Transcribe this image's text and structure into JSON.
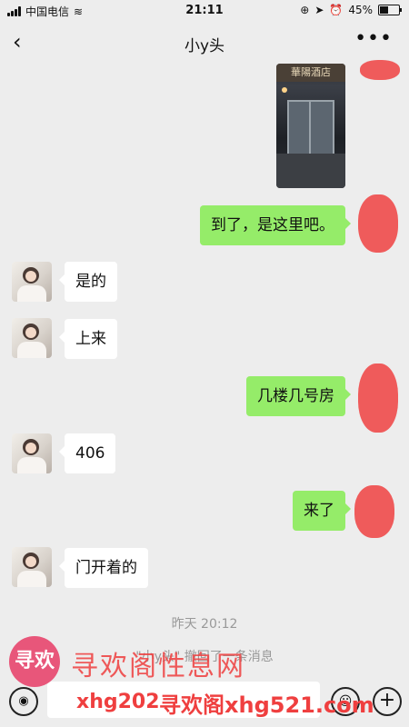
{
  "status_bar": {
    "carrier": "中国电信",
    "time": "21:11",
    "battery": "45%",
    "battery_level": 0.45
  },
  "nav": {
    "back_icon": "‹",
    "title": "小y头",
    "more_icon": "•••"
  },
  "image_message": {
    "sign_text": "華陽酒店"
  },
  "messages": [
    {
      "side": "right",
      "text": "到了，是这里吧。"
    },
    {
      "side": "left",
      "text": "是的"
    },
    {
      "side": "left",
      "text": "上来"
    },
    {
      "side": "right",
      "text": "几楼几号房"
    },
    {
      "side": "left",
      "text": "406"
    },
    {
      "side": "right",
      "text": "来了"
    },
    {
      "side": "left",
      "text": "门开着的"
    }
  ],
  "timestamp": "昨天 20:12",
  "recall_notice": "\"小y头\" 撤回了一条消息",
  "watermark": {
    "logo_text": "寻欢",
    "main": "寻欢阁性息网",
    "partial_url": "xhg202",
    "site": "寻欢阁xhg521.com"
  },
  "input_bar": {
    "voice_icon": "◉",
    "emoji_icon": "☺",
    "plus_icon": "+"
  }
}
